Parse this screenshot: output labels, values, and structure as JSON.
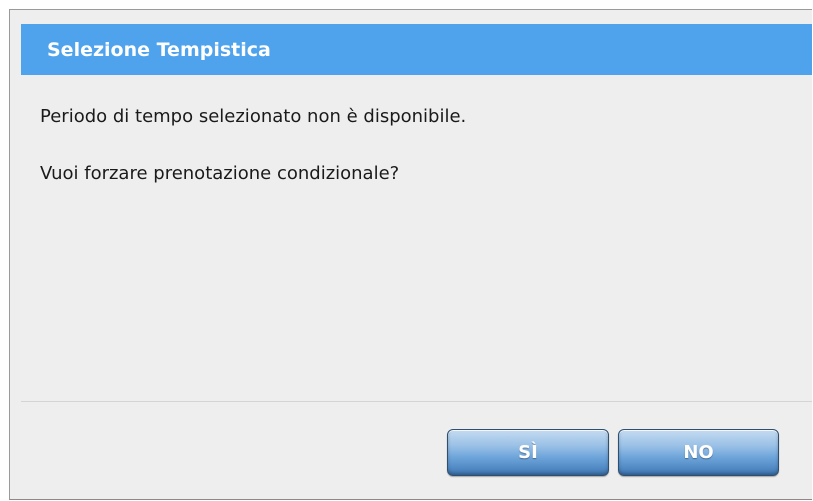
{
  "dialog": {
    "title": "Selezione Tempistica",
    "message_line_1": "Periodo di tempo selezionato non è disponibile.",
    "message_line_2": "Vuoi forzare prenotazione condizionale?",
    "buttons": {
      "yes_label": "SÌ",
      "no_label": "NO"
    }
  },
  "colors": {
    "title_bar": "#4fa3ed",
    "dialog_background": "#eeeeee",
    "button_blue": "#6ea5da"
  }
}
